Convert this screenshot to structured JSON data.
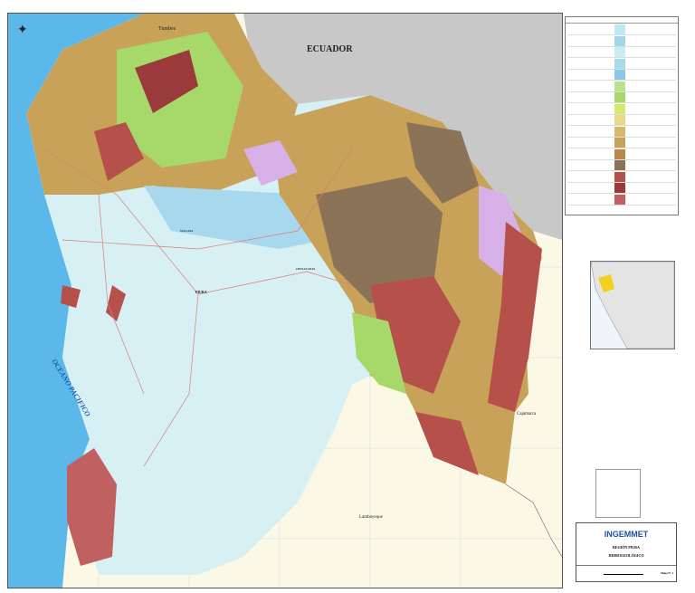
{
  "map": {
    "labels": {
      "ecuador": "ECUADOR",
      "tumbes": "Tumbes",
      "ocean": "OCEANO PACIFICO",
      "piura": "PIURA",
      "sullana": "SULLANA",
      "chulucanas": "CHULUCANAS",
      "cajamarca": "Cajamarca",
      "lambayeque": "Lambayeque"
    },
    "colors": {
      "ocean": "#5bb8e8",
      "aquifer_light": "#d6f0f4",
      "aquifer_blue": "#a8d8ee",
      "sandstone": "#c9a25a",
      "brown": "#8a7356",
      "red": "#b5504a",
      "green": "#a6d96a",
      "purple": "#d7b0e8",
      "ecuador_gray": "#c8c8c8"
    }
  },
  "title_block": {
    "org": "INGEMMET",
    "region": "REGIÓN PIURA",
    "map_type": "HIDROGEOLÓGICO",
    "sheet": "Mapa N° 1"
  },
  "legend": {
    "swatch_colors": [
      "#bfe8f4",
      "#9fd7ef",
      "#c9eef2",
      "#a8d8ee",
      "#8cc7e6",
      "#b8e38a",
      "#a6d96a",
      "#d8e86a",
      "#e8d88a",
      "#d9b86a",
      "#c9a25a",
      "#b88a4a",
      "#8a7356",
      "#b5504a",
      "#9a3a3a",
      "#c06060"
    ]
  }
}
